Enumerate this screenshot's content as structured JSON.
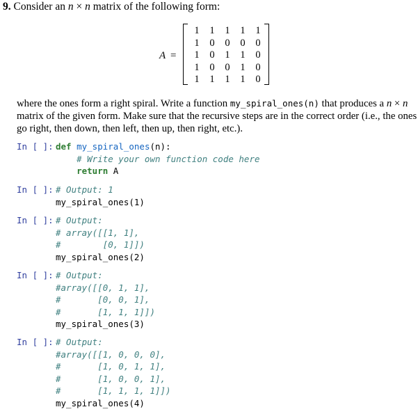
{
  "question": {
    "number": "9.",
    "intro": "Consider an",
    "n1": "n",
    "times": "×",
    "n2": "n",
    "rest": "matrix of the following form:"
  },
  "matrix": {
    "label": "A",
    "equals": "=",
    "rows": [
      [
        "1",
        "1",
        "1",
        "1",
        "1"
      ],
      [
        "1",
        "0",
        "0",
        "0",
        "0"
      ],
      [
        "1",
        "0",
        "1",
        "1",
        "0"
      ],
      [
        "1",
        "0",
        "0",
        "1",
        "0"
      ],
      [
        "1",
        "1",
        "1",
        "1",
        "0"
      ]
    ]
  },
  "paragraph": {
    "line1_a": "where the ones form a right spiral. Write a function ",
    "line1_code": "my_spiral_ones(n)",
    "line1_b": " that produces a ",
    "line1_n1": "n",
    "line1_x": " × ",
    "line1_n2": "n",
    "line2": "matrix of the given form. Make sure that the recursive steps are in the correct order (i.e., the ones",
    "line3": "go right, then down, then left, then up, then right, etc.)."
  },
  "cells": [
    {
      "prompt": "In [ ]:",
      "lines": [
        [
          {
            "t": "def ",
            "c": "kw"
          },
          {
            "t": "my_spiral_ones",
            "c": "fn"
          },
          {
            "t": "(n):",
            "c": ""
          }
        ],
        [
          {
            "t": "    # Write your own function code here",
            "c": "cm"
          }
        ],
        [
          {
            "t": "    ",
            "c": ""
          },
          {
            "t": "return",
            "c": "kw"
          },
          {
            "t": " A",
            "c": ""
          }
        ]
      ]
    },
    {
      "prompt": "In [ ]:",
      "lines": [
        [
          {
            "t": "# Output: 1",
            "c": "cm"
          }
        ],
        [
          {
            "t": "my_spiral_ones(1)",
            "c": ""
          }
        ]
      ]
    },
    {
      "prompt": "In [ ]:",
      "lines": [
        [
          {
            "t": "# Output:",
            "c": "cm"
          }
        ],
        [
          {
            "t": "# array([[1, 1],",
            "c": "cm"
          }
        ],
        [
          {
            "t": "#        [0, 1]])",
            "c": "cm"
          }
        ],
        [
          {
            "t": "my_spiral_ones(2)",
            "c": ""
          }
        ]
      ]
    },
    {
      "prompt": "In [ ]:",
      "lines": [
        [
          {
            "t": "# Output:",
            "c": "cm"
          }
        ],
        [
          {
            "t": "#array([[0, 1, 1],",
            "c": "cm"
          }
        ],
        [
          {
            "t": "#       [0, 0, 1],",
            "c": "cm"
          }
        ],
        [
          {
            "t": "#       [1, 1, 1]])",
            "c": "cm"
          }
        ],
        [
          {
            "t": "my_spiral_ones(3)",
            "c": ""
          }
        ]
      ]
    },
    {
      "prompt": "In [ ]:",
      "lines": [
        [
          {
            "t": "# Output:",
            "c": "cm"
          }
        ],
        [
          {
            "t": "#array([[1, 0, 0, 0],",
            "c": "cm"
          }
        ],
        [
          {
            "t": "#       [1, 0, 1, 1],",
            "c": "cm"
          }
        ],
        [
          {
            "t": "#       [1, 0, 0, 1],",
            "c": "cm"
          }
        ],
        [
          {
            "t": "#       [1, 1, 1, 1]])",
            "c": "cm"
          }
        ],
        [
          {
            "t": "my_spiral_ones(4)",
            "c": ""
          }
        ]
      ]
    }
  ]
}
